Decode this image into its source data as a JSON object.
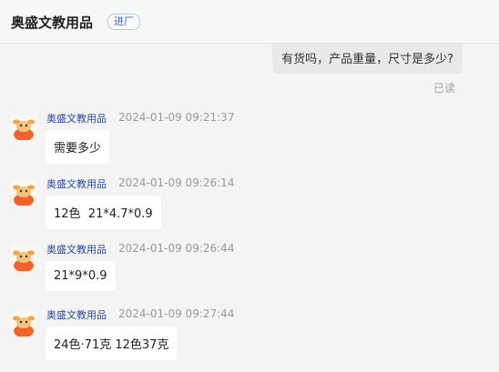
{
  "header": {
    "title": "奥盛文教用品",
    "badge": "进厂"
  },
  "outgoing": {
    "text": "有货吗，产品重量，尺寸是多少?",
    "status": "已读"
  },
  "messages": [
    {
      "sender": "奥盛文教用品",
      "time": "2024-01-09 09:21:37",
      "text": "需要多少"
    },
    {
      "sender": "奥盛文教用品",
      "time": "2024-01-09 09:26:14",
      "text": "12色  21*4.7*0.9"
    },
    {
      "sender": "奥盛文教用品",
      "time": "2024-01-09 09:26:44",
      "text": "21*9*0.9"
    },
    {
      "sender": "奥盛文教用品",
      "time": "2024-01-09 09:27:44",
      "text": "24色·71克 12色37克"
    }
  ]
}
